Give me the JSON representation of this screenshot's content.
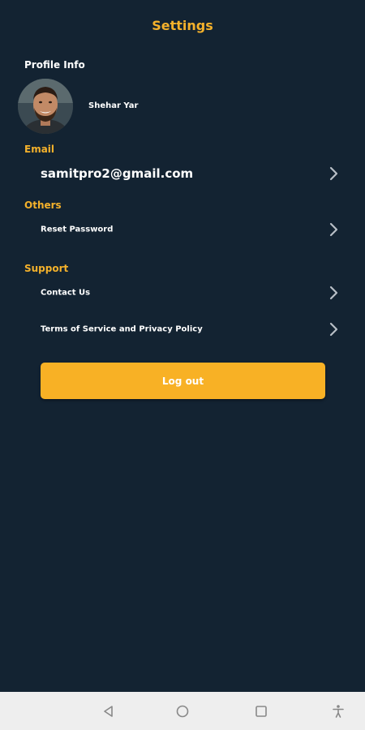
{
  "header": {
    "title": "Settings"
  },
  "profile": {
    "heading": "Profile Info",
    "name": "Shehar Yar"
  },
  "email": {
    "label": "Email",
    "value": "samitpro2@gmail.com"
  },
  "others": {
    "label": "Others",
    "items": [
      {
        "label": "Reset Password"
      }
    ]
  },
  "support": {
    "label": "Support",
    "items": [
      {
        "label": "Contact Us"
      },
      {
        "label": "Terms of Service and Privacy Policy"
      }
    ]
  },
  "logout": {
    "label": "Log out"
  },
  "colors": {
    "background": "#132332",
    "accent": "#f4b12b",
    "button": "#f8b125",
    "navbar": "#eeeeee"
  },
  "icons": {
    "row": "chevron-right-icon",
    "nav": [
      "back-icon",
      "home-icon",
      "recents-icon",
      "accessibility-icon"
    ]
  }
}
